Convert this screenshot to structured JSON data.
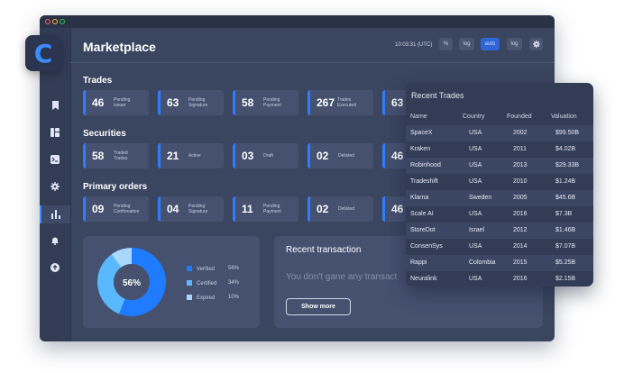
{
  "app": {
    "logo_letter": "C",
    "accent": "#2f7dff"
  },
  "header": {
    "title": "Marketplace",
    "time": "10:03:31 (UTC)",
    "buttons": [
      "%",
      "log",
      "auto",
      "log"
    ],
    "settings_icon": "gear-icon"
  },
  "sidebar": {
    "icons": [
      "bookmark-icon",
      "dashboard-icon",
      "terminal-icon",
      "gear-icon",
      "bar-chart-icon",
      "bell-icon",
      "upload-icon"
    ],
    "active_index": 4
  },
  "sections": [
    {
      "title": "Trades",
      "cards": [
        {
          "value": "46",
          "label": "Pending Issuer"
        },
        {
          "value": "63",
          "label": "Pending Signature"
        },
        {
          "value": "58",
          "label": "Pending Payment"
        },
        {
          "value": "267",
          "label": "Trades Executed"
        },
        {
          "value": "63",
          "label": ""
        }
      ]
    },
    {
      "title": "Securities",
      "cards": [
        {
          "value": "58",
          "label": "Traded Trades"
        },
        {
          "value": "21",
          "label": "Active"
        },
        {
          "value": "03",
          "label": "Draft"
        },
        {
          "value": "02",
          "label": "Delisted"
        },
        {
          "value": "46",
          "label": ""
        }
      ]
    },
    {
      "title": "Primary orders",
      "cards": [
        {
          "value": "09",
          "label": "Pending Confirmation"
        },
        {
          "value": "04",
          "label": "Pending Signature"
        },
        {
          "value": "11",
          "label": "Pending Payment"
        },
        {
          "value": "02",
          "label": "Delisted"
        },
        {
          "value": "46",
          "label": ""
        }
      ]
    }
  ],
  "donut": {
    "center_label": "56%",
    "segments": [
      {
        "name": "Verified",
        "pct_label": "56%",
        "value": 56,
        "color": "#1f7bff"
      },
      {
        "name": "Certified",
        "pct_label": "34%",
        "value": 34,
        "color": "#5ab8ff"
      },
      {
        "name": "Expired",
        "pct_label": "10%",
        "value": 10,
        "color": "#a9d8ff"
      }
    ]
  },
  "recent_transaction": {
    "title": "Recent transaction",
    "empty_text": "You don't gane any transact",
    "button": "Show more"
  },
  "recent_trades": {
    "title": "Recent Trades",
    "columns": [
      "Name",
      "Country",
      "Founded",
      "Valuation"
    ],
    "rows": [
      [
        "SpaceX",
        "USA",
        "2002",
        "$99.50B"
      ],
      [
        "Kraken",
        "USA",
        "2011",
        "$4.02B"
      ],
      [
        "Robinhood",
        "USA",
        "2013",
        "$29.33B"
      ],
      [
        "Tradeshift",
        "USA",
        "2010",
        "$1.24B"
      ],
      [
        "Klarna",
        "Sweden",
        "2005",
        "$45.6B"
      ],
      [
        "Scale AI",
        "USA",
        "2016",
        "$7.3B"
      ],
      [
        "StoreDot",
        "Israel",
        "2012",
        "$1.46B"
      ],
      [
        "ConsenSys",
        "USA",
        "2014",
        "$7.07B"
      ],
      [
        "Rappi",
        "Colombia",
        "2015",
        "$5.25B"
      ],
      [
        "Neuralink",
        "USA",
        "2016",
        "$2.15B"
      ]
    ]
  }
}
